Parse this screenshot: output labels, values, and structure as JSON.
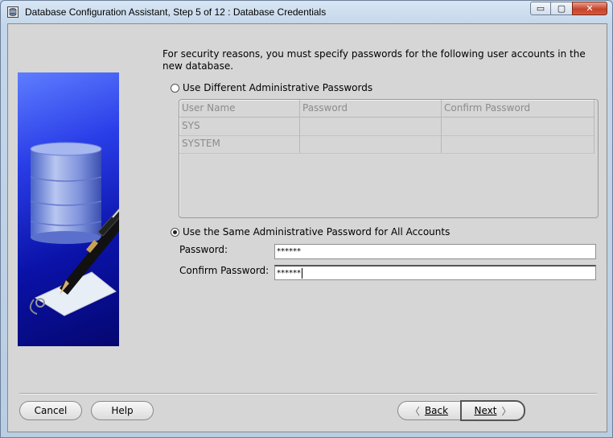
{
  "window": {
    "title": "Database Configuration Assistant, Step 5 of 12 : Database Credentials",
    "controls": {
      "minimize": "▭",
      "maximize": "▢",
      "close": "✕"
    }
  },
  "intro_text": "For security reasons, you must specify passwords for the following user accounts in the new database.",
  "options": {
    "different": {
      "label": "Use Different Administrative Passwords",
      "selected": false
    },
    "same": {
      "label": "Use the Same Administrative Password for All Accounts",
      "selected": true
    }
  },
  "accounts_table": {
    "columns": [
      "User Name",
      "Password",
      "Confirm Password"
    ],
    "rows": [
      {
        "user": "SYS",
        "password": "",
        "confirm": ""
      },
      {
        "user": "SYSTEM",
        "password": "",
        "confirm": ""
      }
    ]
  },
  "password_fields": {
    "password_label": "Password:",
    "password_value": "******",
    "confirm_label": "Confirm Password:",
    "confirm_value": "******"
  },
  "buttons": {
    "cancel": "Cancel",
    "help": "Help",
    "back": "Back",
    "next": "Next"
  },
  "icons": {
    "app": "database-app-icon",
    "side": "database-pen-illustration",
    "back": "chevron-left-icon",
    "next": "chevron-right-icon"
  }
}
